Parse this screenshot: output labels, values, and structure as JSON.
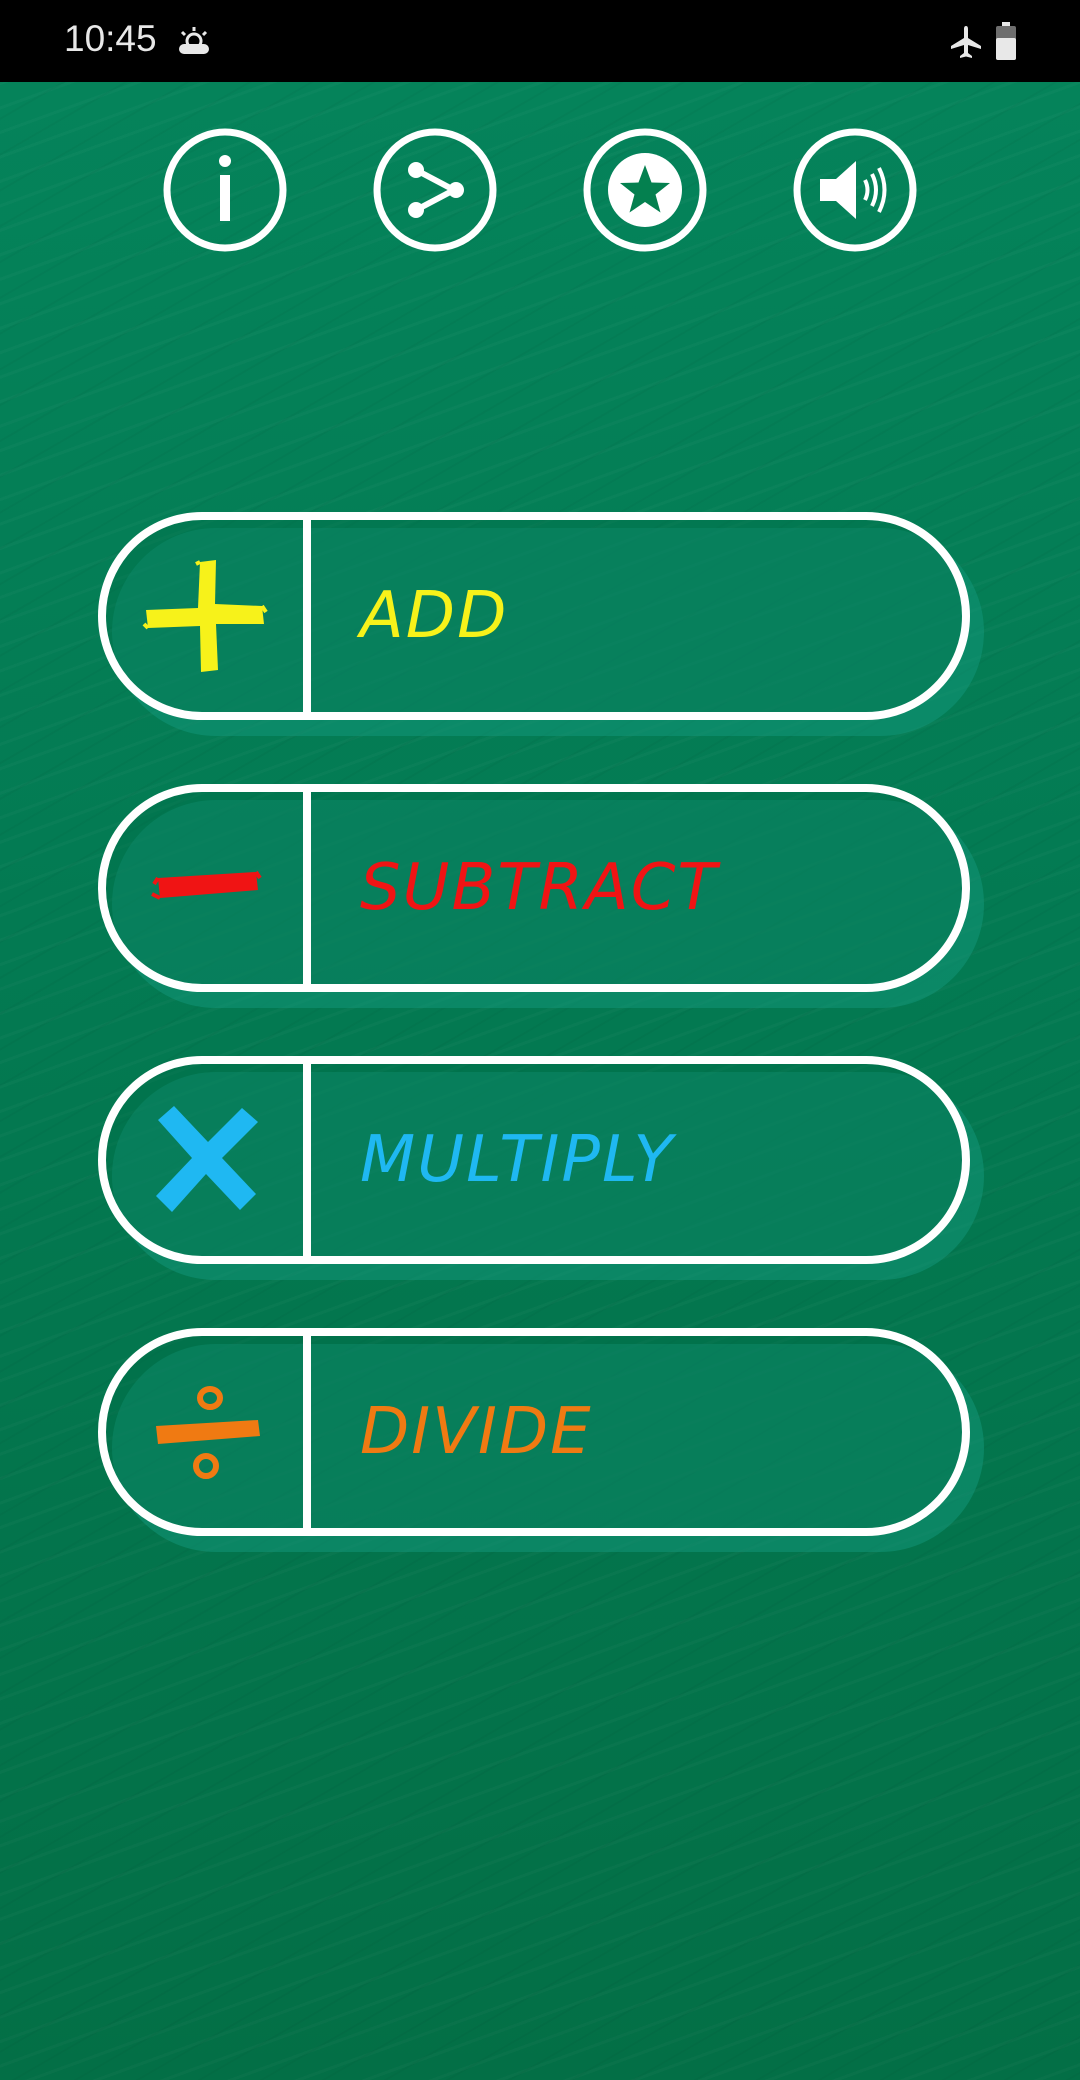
{
  "status_bar": {
    "time": "10:45",
    "weather_icon": "cloudy-sun-icon",
    "airplane_icon": "airplane-icon",
    "battery_icon": "battery-icon"
  },
  "toolbar": {
    "items": [
      {
        "icon": "info-icon",
        "name": "info"
      },
      {
        "icon": "share-icon",
        "name": "share"
      },
      {
        "icon": "star-icon",
        "name": "rate"
      },
      {
        "icon": "volume-icon",
        "name": "sound"
      }
    ]
  },
  "operations": [
    {
      "label": "ADD",
      "icon": "plus-icon",
      "color": "#f7f21a"
    },
    {
      "label": "SUBTRACT",
      "icon": "minus-icon",
      "color": "#f01414"
    },
    {
      "label": "MULTIPLY",
      "icon": "multiply-icon",
      "color": "#1fb8f2"
    },
    {
      "label": "DIVIDE",
      "icon": "divide-icon",
      "color": "#f07a12"
    }
  ],
  "colors": {
    "background": "#04804f",
    "outline": "#ffffff",
    "status_bar": "#000000"
  }
}
